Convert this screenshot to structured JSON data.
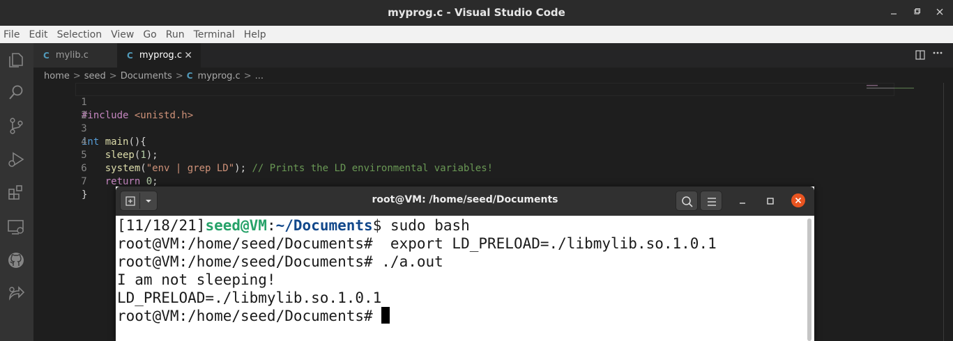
{
  "window": {
    "title": "myprog.c - Visual Studio Code"
  },
  "menu": [
    "File",
    "Edit",
    "Selection",
    "View",
    "Go",
    "Run",
    "Terminal",
    "Help"
  ],
  "tabs": [
    {
      "icon": "C",
      "label": "mylib.c"
    },
    {
      "icon": "C",
      "label": "myprog.c",
      "close": "✕"
    }
  ],
  "breadcrumb": {
    "parts": [
      "home",
      "seed",
      "Documents"
    ],
    "file_icon": "C",
    "file": "myprog.c",
    "tail": "...",
    "sep": ">"
  },
  "editor": {
    "line_numbers": [
      "1",
      "2",
      "3",
      "4",
      "5",
      "6",
      "7"
    ],
    "line1": {
      "directive": "#include",
      "header": "<unistd.h>"
    },
    "line3": {
      "type": "int",
      "fn": "main",
      "rest": "(){"
    },
    "line4": {
      "fn": "sleep",
      "open": "(",
      "num": "1",
      "close": ");"
    },
    "line5": {
      "fn": "system",
      "open": "(",
      "str": "\"env | grep LD\"",
      "close": "); ",
      "comment": "// Prints the LD environmental variables!"
    },
    "line6": {
      "kw": "return",
      "num": "0",
      "end": ";"
    },
    "line7": {
      "text": "}"
    }
  },
  "terminal": {
    "title": "root@VM: /home/seed/Documents",
    "lines": {
      "l1_date": "[11/18/21]",
      "l1_user": "seed@VM",
      "l1_colon": ":",
      "l1_path": "~/Documents",
      "l1_cmd": "$ sudo bash",
      "l2": "root@VM:/home/seed/Documents#  export LD_PRELOAD=./libmylib.so.1.0.1",
      "l3": "root@VM:/home/seed/Documents# ./a.out",
      "l4": "I am not sleeping!",
      "l5": "LD_PRELOAD=./libmylib.so.1.0.1",
      "l6": "root@VM:/home/seed/Documents# "
    }
  },
  "colors": {
    "prompt_user": "#26a269",
    "prompt_path": "#12488b",
    "close_button": "#e95420"
  }
}
